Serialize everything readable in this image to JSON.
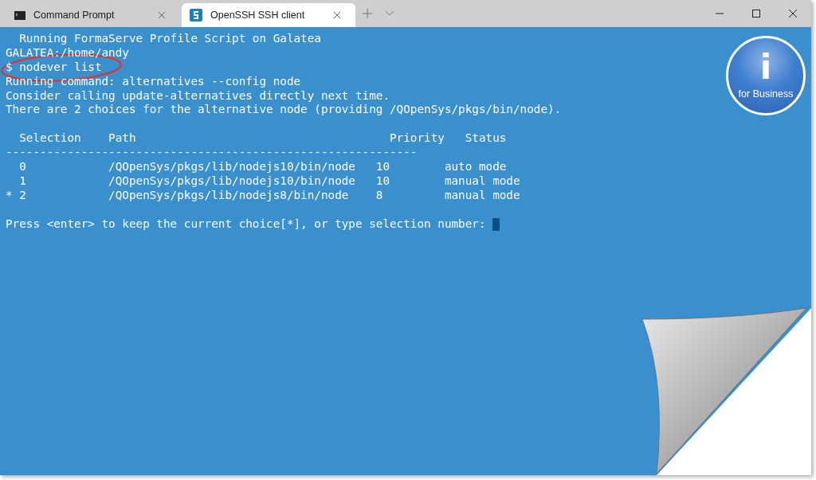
{
  "tabs": [
    {
      "label": "Command Prompt",
      "selected": false
    },
    {
      "label": "OpenSSH SSH client",
      "selected": true
    }
  ],
  "logo": {
    "letter": "i",
    "caption": "for Business"
  },
  "terminal": {
    "lines": [
      {
        "kind": "text",
        "text": "  Running FormaServe Profile Script on Galatea"
      },
      {
        "kind": "text",
        "text": "GALATEA:/home/andy"
      },
      {
        "kind": "text",
        "text": "$ nodever list",
        "circled": true
      },
      {
        "kind": "text",
        "text": "Running command: alternatives --config node"
      },
      {
        "kind": "text",
        "text": "Consider calling update-alternatives directly next time."
      },
      {
        "kind": "text",
        "text": "There are 2 choices for the alternative node (providing /QOpenSys/pkgs/bin/node)."
      },
      {
        "kind": "blank"
      },
      {
        "kind": "text",
        "text": "  Selection    Path                                     Priority   Status"
      },
      {
        "kind": "text",
        "text": "------------------------------------------------------------"
      },
      {
        "kind": "text",
        "text": "  0            /QOpenSys/pkgs/lib/nodejs10/bin/node   10        auto mode"
      },
      {
        "kind": "text",
        "text": "  1            /QOpenSys/pkgs/lib/nodejs10/bin/node   10        manual mode"
      },
      {
        "kind": "text",
        "text": "* 2            /QOpenSys/pkgs/lib/nodejs8/bin/node    8         manual mode"
      },
      {
        "kind": "blank"
      },
      {
        "kind": "prompt",
        "text": "Press <enter> to keep the current choice[*], or type selection number: "
      }
    ]
  }
}
